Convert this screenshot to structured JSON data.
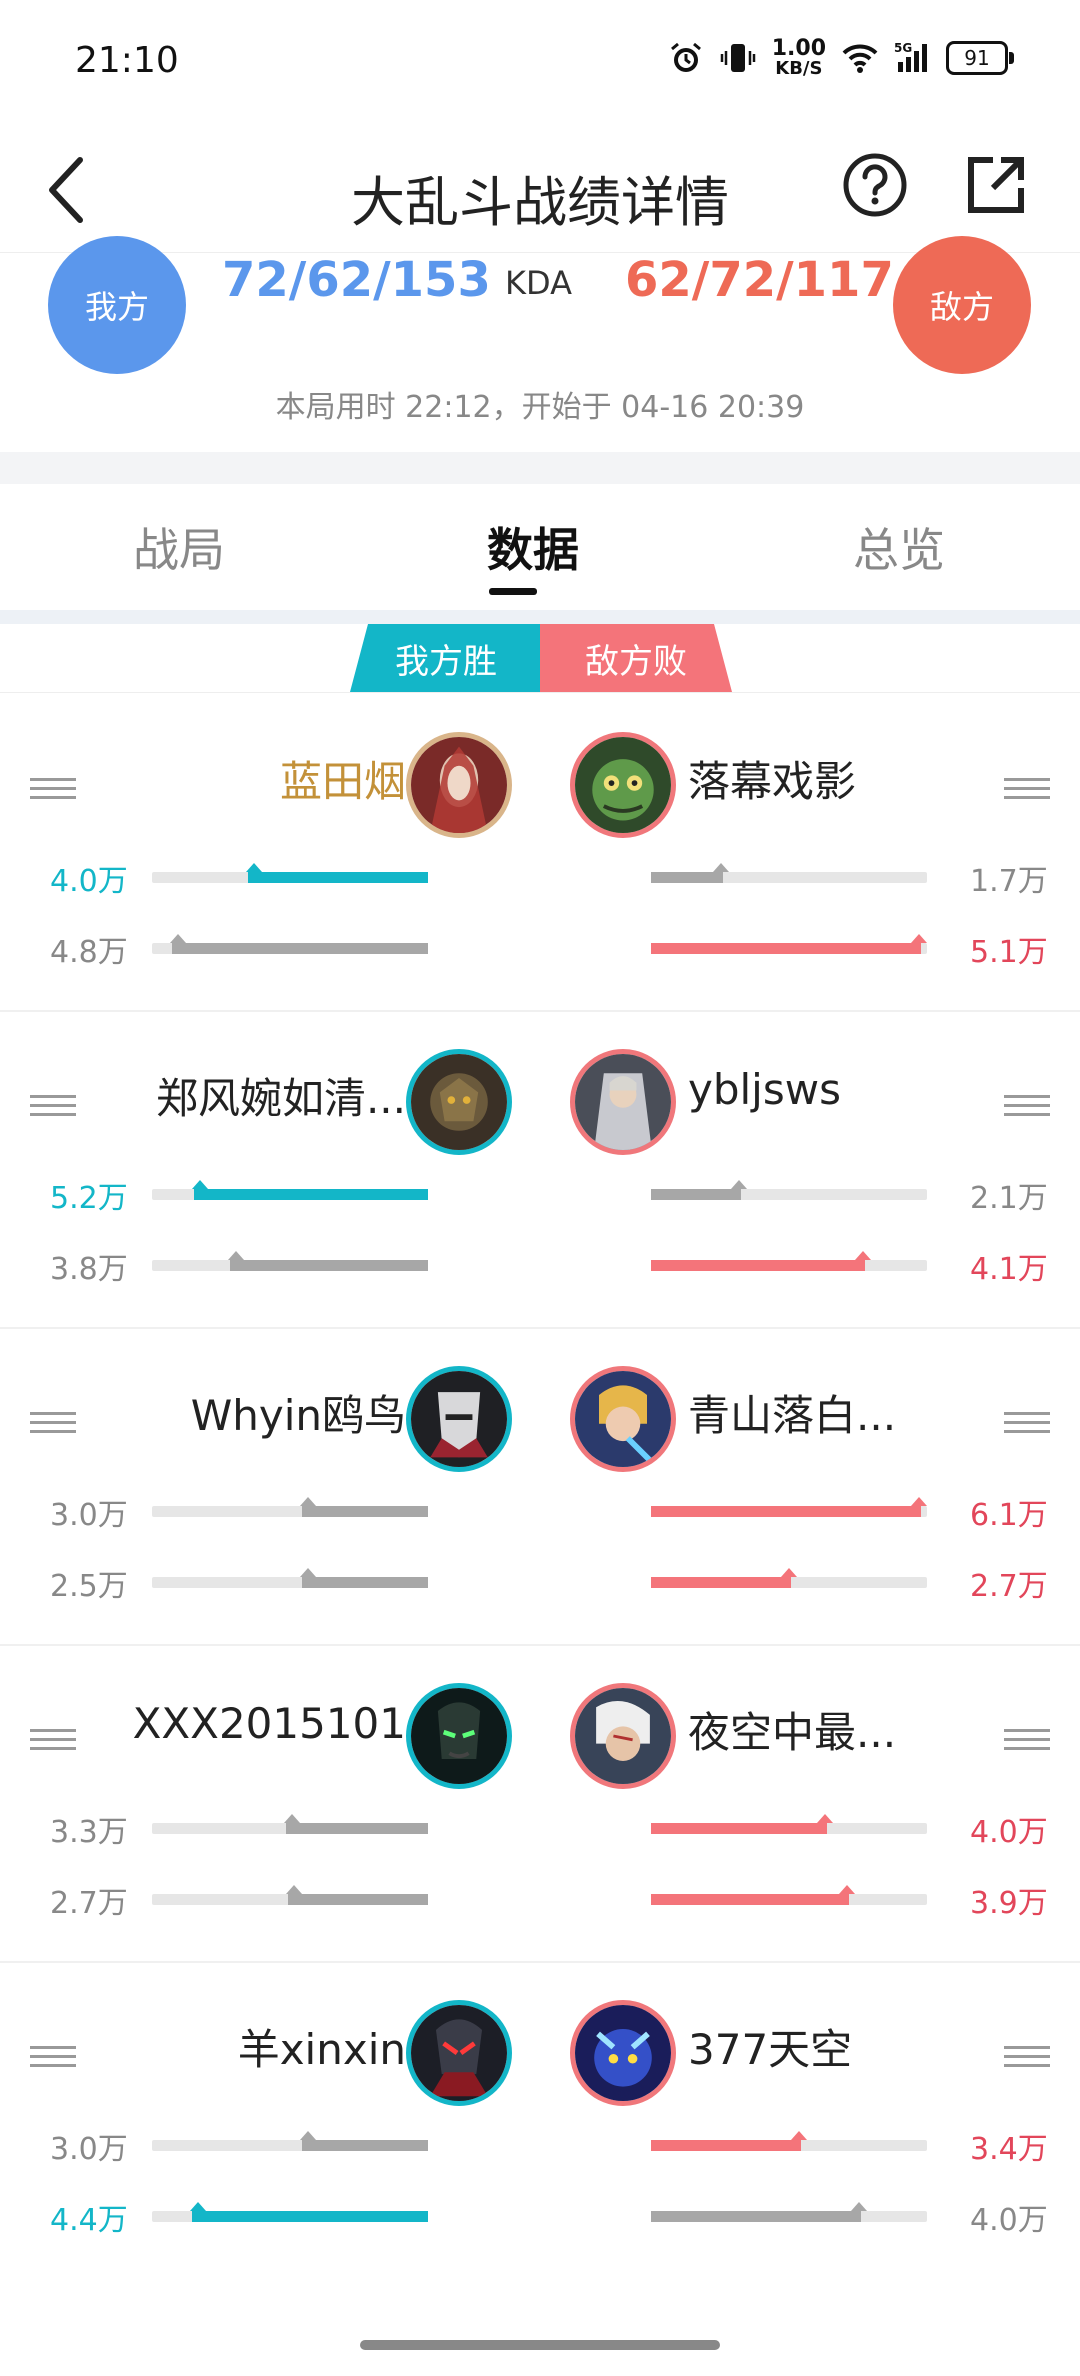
{
  "status_bar": {
    "time": "21:10",
    "speed_top": "1.00",
    "speed_unit": "KB/S",
    "battery": "91"
  },
  "header": {
    "title": "大乱斗战绩详情"
  },
  "summary": {
    "ours_label": "我方",
    "theirs_label": "敌方",
    "kda_ours": "72/62/153",
    "kda_label": "KDA",
    "kda_theirs": "62/72/117",
    "duration": "本局用时 22:12，开始于 04-16 20:39"
  },
  "tabs": [
    {
      "label": "战局"
    },
    {
      "label": "数据"
    },
    {
      "label": "总览"
    }
  ],
  "result": {
    "win": "我方胜",
    "lose": "敌方败"
  },
  "rows": [
    {
      "left": {
        "name": "蓝田烟",
        "stat1": "4.0万",
        "stat2": "4.8万"
      },
      "right": {
        "name": "落幕戏影",
        "stat1": "1.7万",
        "stat2": "5.1万"
      }
    },
    {
      "left": {
        "name": "郑风婉如清...",
        "stat1": "5.2万",
        "stat2": "3.8万"
      },
      "right": {
        "name": "ybljsws",
        "stat1": "2.1万",
        "stat2": "4.1万"
      }
    },
    {
      "left": {
        "name": "Whyin鸥鸟",
        "stat1": "3.0万",
        "stat2": "2.5万"
      },
      "right": {
        "name": "青山落白...",
        "stat1": "6.1万",
        "stat2": "2.7万"
      }
    },
    {
      "left": {
        "name": "XXX2015101",
        "stat1": "3.3万",
        "stat2": "2.7万"
      },
      "right": {
        "name": "夜空中最...",
        "stat1": "4.0万",
        "stat2": "3.9万"
      }
    },
    {
      "left": {
        "name": "羊xinxin",
        "stat1": "3.0万",
        "stat2": "4.4万"
      },
      "right": {
        "name": "377天空",
        "stat1": "3.4万",
        "stat2": "4.0万"
      }
    }
  ],
  "colors": {
    "teal": "#13b6c8",
    "red": "#f4747a",
    "blue": "#5b97ec",
    "orange": "#ee6a56",
    "gold": "#c39139"
  }
}
